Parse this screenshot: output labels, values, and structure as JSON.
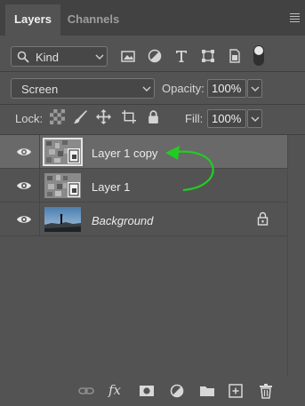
{
  "tabs": [
    {
      "label": "Layers",
      "active": true
    },
    {
      "label": "Channels",
      "active": false
    }
  ],
  "filter": {
    "kind_label": "Kind",
    "icons": [
      "image-filter-icon",
      "adjustment-filter-icon",
      "type-filter-icon",
      "shape-filter-icon",
      "smart-object-filter-icon"
    ],
    "toggle_on": true
  },
  "blend": {
    "mode": "Screen",
    "opacity_label": "Opacity:",
    "opacity_value": "100%"
  },
  "lock": {
    "label": "Lock:",
    "icons": [
      "lock-transparent-pixels-icon",
      "lock-image-pixels-icon",
      "lock-position-icon",
      "lock-artboard-icon",
      "lock-all-icon"
    ],
    "fill_label": "Fill:",
    "fill_value": "100%"
  },
  "layers": [
    {
      "name": "Layer 1 copy",
      "selected": true,
      "visible": true,
      "smart_object": true
    },
    {
      "name": "Layer 1",
      "selected": false,
      "visible": true,
      "smart_object": true
    },
    {
      "name": "Background",
      "selected": false,
      "visible": true,
      "locked": true
    }
  ],
  "bottom_bar": {
    "icons": [
      "link-layers-icon",
      "layer-style-fx-icon",
      "add-mask-icon",
      "new-adjustment-icon",
      "new-group-icon",
      "new-layer-icon",
      "delete-layer-icon"
    ],
    "fx_label": "fx"
  },
  "colors": {
    "panel_bg": "#535353",
    "tabbar_bg": "#424242",
    "selected_row": "#696969",
    "annotation_arrow": "#22cc22"
  }
}
